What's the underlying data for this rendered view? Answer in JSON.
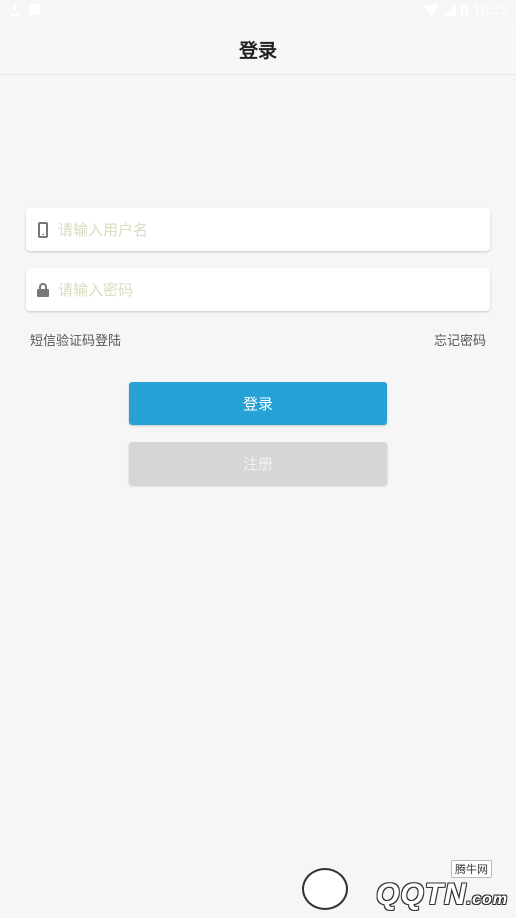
{
  "status_bar": {
    "time": "10:25",
    "left_icons": [
      "download-icon",
      "notification-icon"
    ],
    "right_icons": [
      "wifi-icon",
      "signal-icon",
      "battery-icon"
    ]
  },
  "header": {
    "title": "登录"
  },
  "form": {
    "username": {
      "placeholder": "请输入用户名",
      "value": "",
      "icon": "phone-icon"
    },
    "password": {
      "placeholder": "请输入密码",
      "value": "",
      "icon": "lock-icon"
    },
    "sms_login_label": "短信验证码登陆",
    "forgot_password_label": "忘记密码"
  },
  "buttons": {
    "login_label": "登录",
    "register_label": "注册"
  },
  "watermark": {
    "tag": "腾牛网",
    "logo": "QQTN",
    "logo_suffix": ".com"
  },
  "colors": {
    "background": "#f6f6f6",
    "accent": "#26a2d6",
    "disabled": "#d6d6d6",
    "placeholder": "#d8dcc0"
  }
}
